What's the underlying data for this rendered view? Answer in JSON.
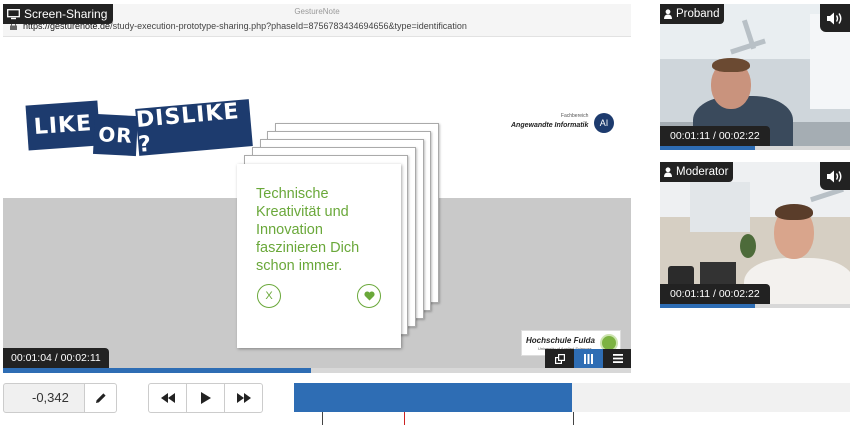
{
  "screen_share": {
    "panel_label": "Screen-Sharing",
    "browser": {
      "doc_title": "GestureNote",
      "url_host": "https://gesturenote.de",
      "url_path": "/study-execution-prototype-sharing.php?phaseId=8756783434694656&type=identification"
    },
    "slide": {
      "banner_words": [
        "LIKE",
        "OR",
        "DISLIKE ?"
      ],
      "dept_small": "Fachbereich",
      "dept_name": "Angewandte Informatik",
      "dept_badge": "AI",
      "card_text": "Technische Kreativität und Innovation faszinieren Dich schon immer.",
      "dislike_label": "X",
      "like_icon": "heart-icon",
      "university_name": "Hochschule Fulda",
      "university_subtitle": "University of Applied Sciences"
    },
    "time": "00:01:04 / 00:02:11",
    "progress_fraction": 0.49,
    "view_buttons": [
      "popout-icon",
      "columns-icon",
      "list-icon"
    ],
    "active_view": "columns-icon"
  },
  "webcams": [
    {
      "label": "Proband",
      "time": "00:01:11 / 00:02:22",
      "progress_fraction": 0.5,
      "audio_icon": "volume-icon"
    },
    {
      "label": "Moderator",
      "time": "00:01:11 / 00:02:22",
      "progress_fraction": 0.5,
      "audio_icon": "volume-icon"
    }
  ],
  "controls": {
    "offset_value": "-0,342",
    "timeline_progress_fraction": 0.5
  },
  "colors": {
    "accent": "#2e6db4",
    "badge_bg": "#222222",
    "slide_green": "#6aa83a",
    "banner_navy": "#1d3b6e"
  }
}
